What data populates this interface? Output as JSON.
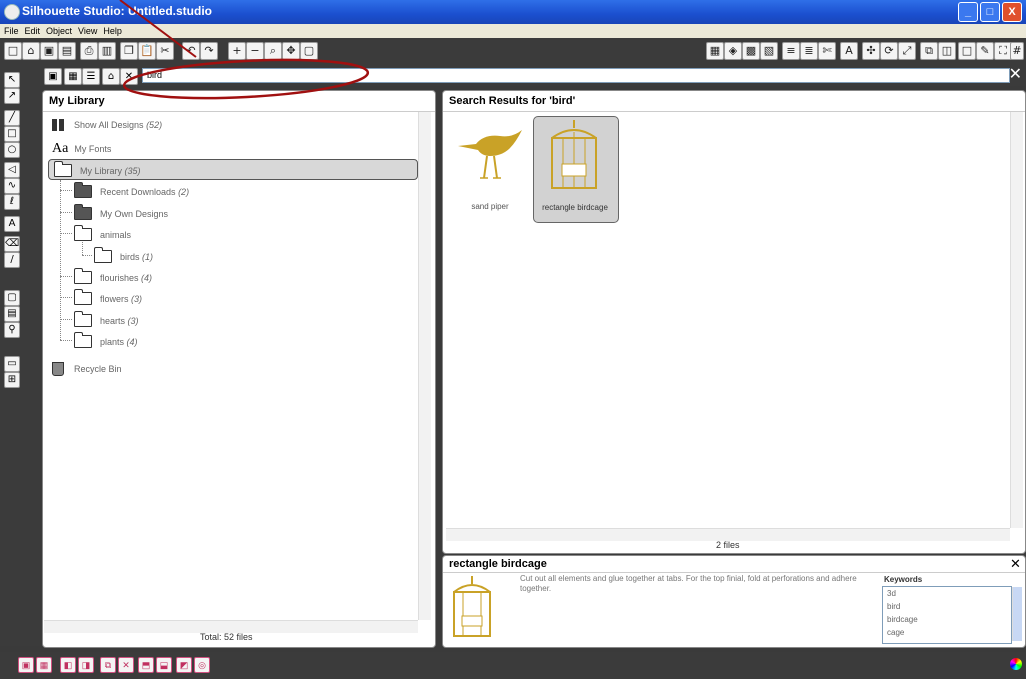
{
  "window": {
    "title": "Silhouette Studio: Untitled.studio",
    "btn_min": "_",
    "btn_max": "□",
    "btn_close": "X"
  },
  "menu": [
    "File",
    "Edit",
    "Object",
    "View",
    "Help"
  ],
  "search": {
    "value": "bird",
    "clear_glyph": "✕"
  },
  "library_panel": {
    "title": "My Library",
    "items": [
      {
        "label": "Show All Designs",
        "count": "(52)"
      },
      {
        "label": "My Fonts",
        "count": "",
        "icon_text": "Aa"
      },
      {
        "label": "My Library",
        "count": "(35)"
      },
      {
        "label": "Recent Downloads",
        "count": "(2)"
      },
      {
        "label": "My Own Designs",
        "count": ""
      },
      {
        "label": "animals",
        "count": ""
      },
      {
        "label": "birds",
        "count": "(1)"
      },
      {
        "label": "flourishes",
        "count": "(4)"
      },
      {
        "label": "flowers",
        "count": "(3)"
      },
      {
        "label": "hearts",
        "count": "(3)"
      },
      {
        "label": "plants",
        "count": "(4)"
      },
      {
        "label": "Recycle Bin",
        "count": ""
      }
    ],
    "total": "Total: 52 files"
  },
  "results_panel": {
    "title": "Search Results for 'bird'",
    "items": [
      {
        "label": "sand piper"
      },
      {
        "label": "rectangle birdcage"
      }
    ],
    "file_count": "2 files"
  },
  "detail": {
    "title": "rectangle birdcage",
    "description": "Cut out all elements and glue together at tabs. For the top finial, fold at perforations and adhere together.",
    "keywords_label": "Keywords",
    "keywords": [
      "3d",
      "bird",
      "birdcage",
      "cage"
    ],
    "close_glyph": "✕"
  },
  "colors": {
    "gold": "#c9a227",
    "annotation": "#a01010"
  }
}
